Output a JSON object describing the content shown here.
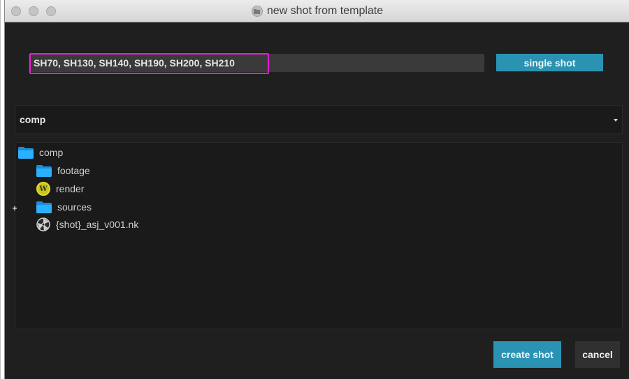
{
  "window": {
    "title": "new shot from template"
  },
  "shot_input": {
    "value": "SH70, SH130, SH140, SH190, SH200, SH210"
  },
  "buttons": {
    "single_shot": "single shot",
    "create_shot": "create shot",
    "cancel": "cancel"
  },
  "template_dropdown": {
    "selected": "comp"
  },
  "tree": {
    "items": [
      {
        "label": "comp",
        "icon": "folder-icon"
      },
      {
        "label": "footage",
        "icon": "folder-icon"
      },
      {
        "label": "render",
        "icon": "write-node-icon",
        "glyph": "W"
      },
      {
        "label": "sources",
        "icon": "folder-icon",
        "expander": "+"
      },
      {
        "label": "{shot}_asj_v001.nk",
        "icon": "nuke-script-icon"
      }
    ]
  },
  "colors": {
    "accent": "#2a93b4",
    "folder": "#1fa2f0",
    "render": "#c9c51a",
    "selection_outline": "#e020d0"
  }
}
